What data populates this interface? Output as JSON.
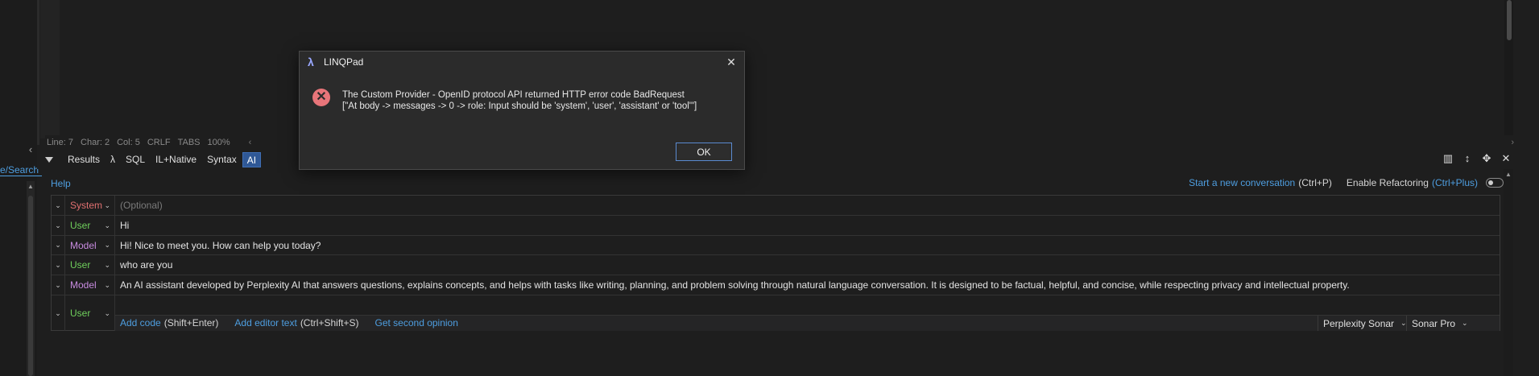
{
  "status_bar": {
    "line": "Line: 7",
    "char": "Char: 2",
    "col": "Col: 5",
    "eol": "CRLF",
    "indent": "TABS",
    "zoom": "100%"
  },
  "left_panel": {
    "link_text": "e/Search"
  },
  "tabs": [
    {
      "label": "Results"
    },
    {
      "label": "λ"
    },
    {
      "label": "SQL"
    },
    {
      "label": "IL+Native"
    },
    {
      "label": "Syntax"
    },
    {
      "label": "AI",
      "active": true
    }
  ],
  "ai_panel": {
    "help_label": "Help",
    "start_conversation": "Start a new conversation",
    "start_conversation_shortcut": "(Ctrl+P)",
    "enable_refactoring": "Enable Refactoring",
    "enable_refactoring_shortcut": "(Ctrl+Plus)",
    "enable_refactoring_on": false,
    "messages": [
      {
        "role": "System",
        "text": "",
        "placeholder": "(Optional)"
      },
      {
        "role": "User",
        "text": "Hi"
      },
      {
        "role": "Model",
        "text": "Hi! Nice to meet you. How can help you today?"
      },
      {
        "role": "User",
        "text": "who are you"
      },
      {
        "role": "Model",
        "text": "An AI assistant developed by Perplexity AI that answers questions, explains concepts, and helps with tasks like writing, planning, and problem solving through natural language conversation. It is designed to be factual, helpful, and concise, while respecting privacy and intellectual property."
      },
      {
        "role": "User",
        "text": ""
      }
    ],
    "footer": {
      "add_code": "Add code",
      "add_code_shortcut": "(Shift+Enter)",
      "add_editor_text": "Add editor text",
      "add_editor_text_shortcut": "(Ctrl+Shift+S)",
      "second_opinion": "Get second opinion",
      "provider": "Perplexity Sonar",
      "model": "Sonar Pro"
    }
  },
  "dialog": {
    "title": "LINQPad",
    "message_line1": "The Custom Provider - OpenID protocol API returned HTTP error code BadRequest",
    "message_line2": "[\"At body -> messages -> 0 -> role: Input should be 'system', 'user', 'assistant' or 'tool'\"]",
    "ok_label": "OK"
  },
  "colors": {
    "accent": "#4e9ee0",
    "user_role": "#6fcf5c",
    "model_role": "#c88be0",
    "system_role": "#e07070",
    "error_icon": "#e8757a",
    "active_tab": "#2f5896"
  }
}
